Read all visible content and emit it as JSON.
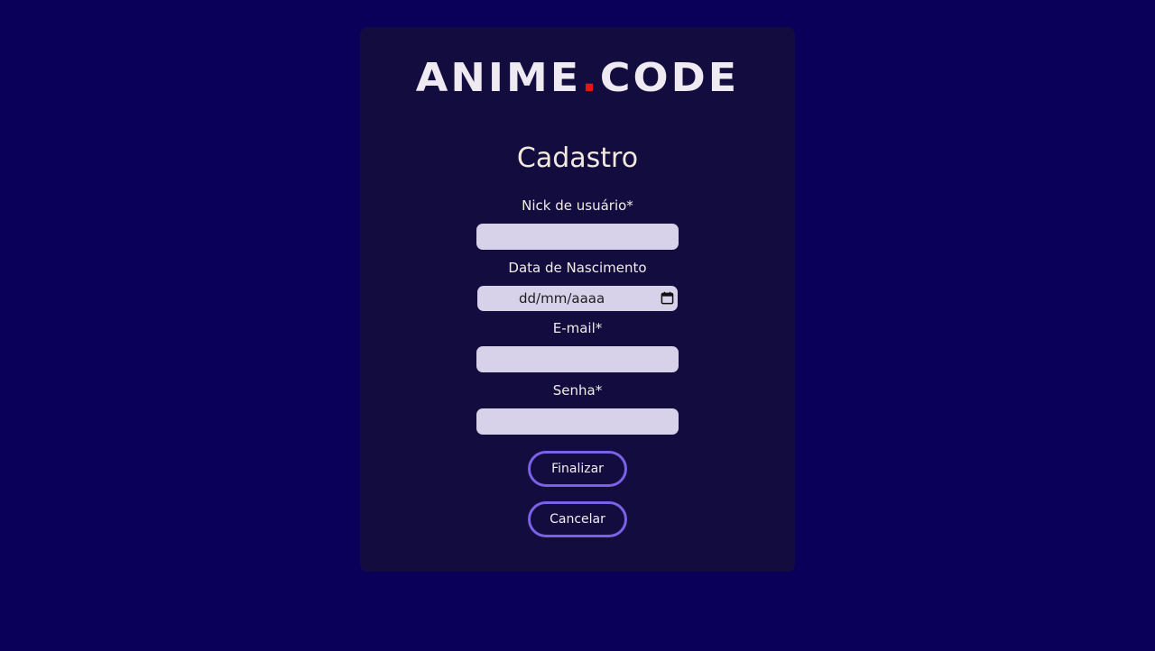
{
  "logo": {
    "part1": "ANIME",
    "dot": ".",
    "part2": "CODE"
  },
  "form": {
    "title": "Cadastro",
    "nick_label": "Nick de usuário*",
    "nick_value": "",
    "birth_label": "Data de Nascimento",
    "birth_placeholder": "dd/mm/aaaa",
    "email_label": "E-mail*",
    "email_value": "",
    "password_label": "Senha*",
    "password_value": "",
    "submit_label": "Finalizar",
    "cancel_label": "Cancelar"
  },
  "icons": {
    "calendar": "calendar-icon"
  },
  "colors": {
    "page_bg": "#0a005a",
    "card_bg": "#130c3f",
    "input_bg": "#d7d1ea",
    "button_border": "#7a61e6",
    "logo_dot": "#e8141a"
  }
}
